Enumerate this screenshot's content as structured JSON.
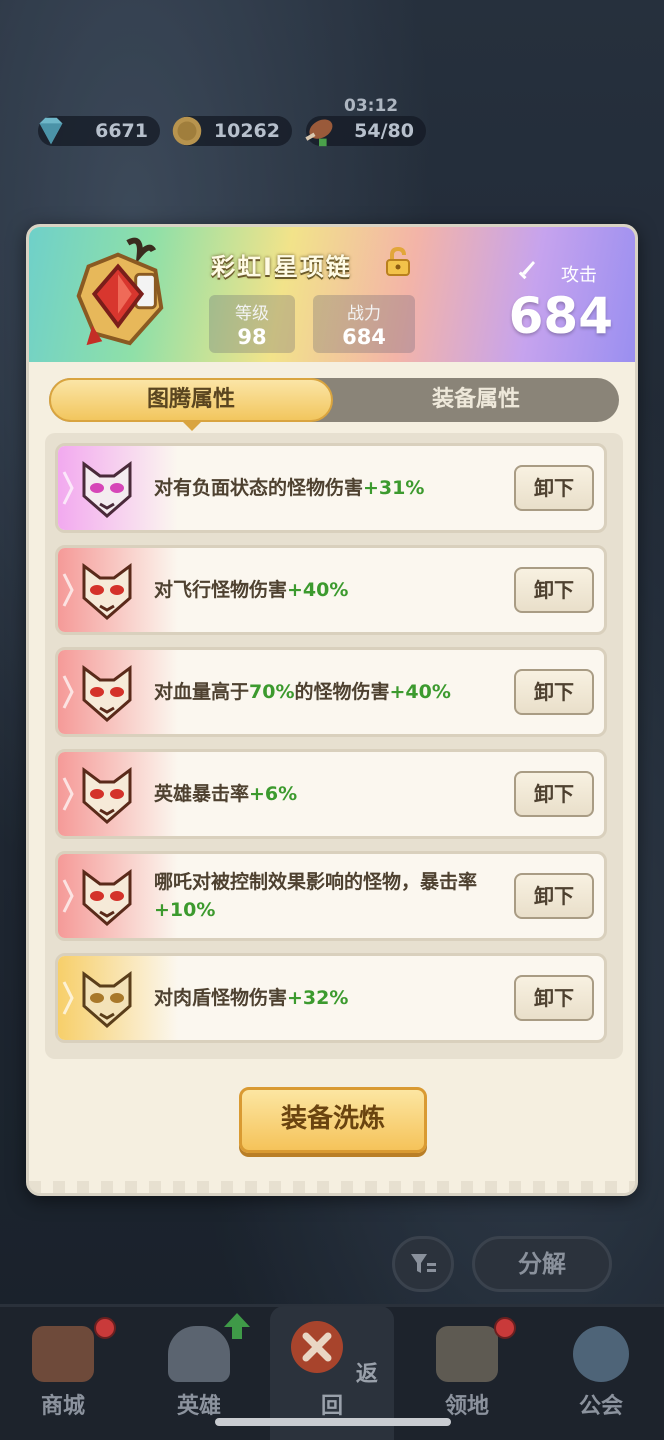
{
  "resources": {
    "gems": "6671",
    "coins": "10262",
    "stamina": "54/80",
    "timer": "03:12"
  },
  "item": {
    "name": "彩虹I星项链",
    "level_label": "等级",
    "level": "98",
    "power_label": "战力",
    "power": "684",
    "attack_label": "攻击",
    "attack_value": "684"
  },
  "tabs": [
    {
      "label": "图腾属性",
      "active": true
    },
    {
      "label": "装备属性",
      "active": false
    }
  ],
  "attributes": [
    {
      "prefix": "对有负面状态的怪物伤害",
      "bonus": "+31%",
      "rarity": "purple",
      "unequip": "卸下"
    },
    {
      "prefix": "对飞行怪物伤害",
      "bonus": "+40%",
      "rarity": "red",
      "unequip": "卸下"
    },
    {
      "prefix": "对血量高于",
      "mid": "70%",
      "suffix": "的怪物伤害",
      "bonus": "+40%",
      "rarity": "red",
      "unequip": "卸下"
    },
    {
      "prefix": "英雄暴击率",
      "bonus": "+6%",
      "rarity": "red",
      "unequip": "卸下"
    },
    {
      "prefix": "哪吒对被控制效果影响的怪物，暴击率",
      "bonus": "+10%",
      "rarity": "red",
      "unequip": "卸下"
    },
    {
      "prefix": "对肉盾怪物伤害",
      "bonus": "+32%",
      "rarity": "gold",
      "unequip": "卸下"
    }
  ],
  "refine_button": "装备洗炼",
  "util": {
    "decompose": "分解",
    "filter_icon": "filter-icon"
  },
  "nav": [
    {
      "label": "商城",
      "icon": "shop-icon",
      "badge": true
    },
    {
      "label": "英雄",
      "icon": "hero-icon",
      "upgrade": true
    },
    {
      "label": "返回",
      "icon": "close-icon"
    },
    {
      "label": "领地",
      "icon": "castle-icon",
      "badge": true
    },
    {
      "label": "公会",
      "icon": "planet-icon"
    }
  ],
  "colors": {
    "positive": "#3c9a2e",
    "purple": "#e58be8",
    "red": "#f08a88",
    "gold": "#f2c55c"
  }
}
